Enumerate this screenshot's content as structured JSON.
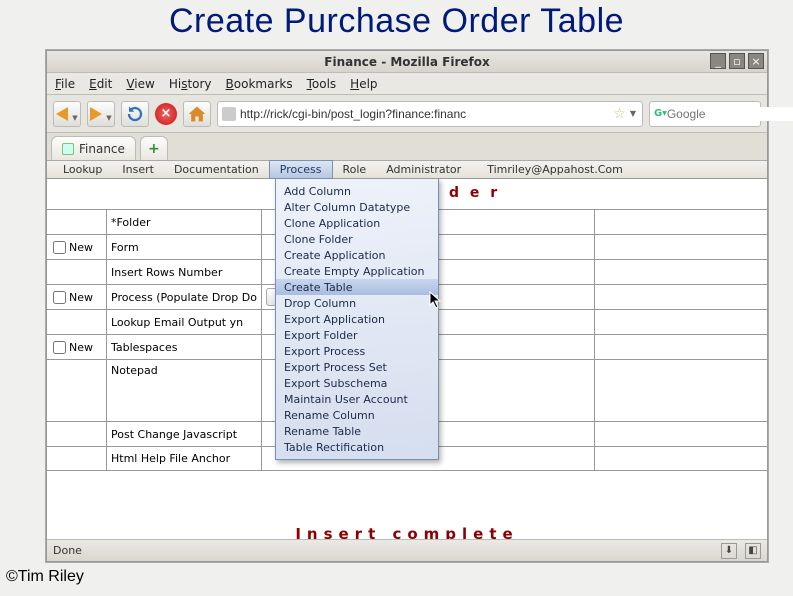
{
  "slide": {
    "title": "Create Purchase Order Table",
    "copyright": "©Tim Riley"
  },
  "window": {
    "title": "Finance - Mozilla Firefox",
    "btn_min": "_",
    "btn_max": "▫",
    "btn_close": "×"
  },
  "menubar": {
    "file": "File",
    "edit": "Edit",
    "view": "View",
    "history": "History",
    "bookmarks": "Bookmarks",
    "tools": "Tools",
    "help": "Help"
  },
  "toolbar": {
    "url": "http://rick/cgi-bin/post_login?finance:financ",
    "search_placeholder": "Google"
  },
  "tabs": {
    "active": "Finance"
  },
  "appmenu": {
    "items": [
      "Lookup",
      "Insert",
      "Documentation",
      "Process",
      "Role",
      "Administrator"
    ],
    "active": "Process",
    "email": "Timriley@Appahost.Com"
  },
  "page": {
    "heading_partial": "d e r",
    "rows": {
      "r0_chk": "",
      "r0_lbl": "*Folder",
      "r1_new": "New",
      "r1_lbl": "Form",
      "r2_chk": "",
      "r2_lbl": "Insert Rows Number",
      "r3_new": "New",
      "r3_lbl": "Process (Populate Drop Do",
      "r4_chk": "",
      "r4_lbl": "Lookup Email Output yn",
      "r5_new": "New",
      "r5_lbl": "Tablespaces",
      "r6_chk": "",
      "r6_lbl": "Notepad",
      "r7_chk": "",
      "r7_lbl": "Post Change Javascript",
      "r8_chk": "",
      "r8_lbl": "Html Help File Anchor"
    },
    "result": "Insert complete",
    "status": "Done"
  },
  "dropdown": {
    "items": [
      "Add Column",
      "Alter Column Datatype",
      "Clone Application",
      "Clone Folder",
      "Create Application",
      "Create Empty Application",
      "Create Table",
      "Drop Column",
      "Export Application",
      "Export Folder",
      "Export Process",
      "Export Process Set",
      "Export Subschema",
      "Maintain User Account",
      "Rename Column",
      "Rename Table",
      "Table Rectification"
    ],
    "hover": "Create Table"
  }
}
